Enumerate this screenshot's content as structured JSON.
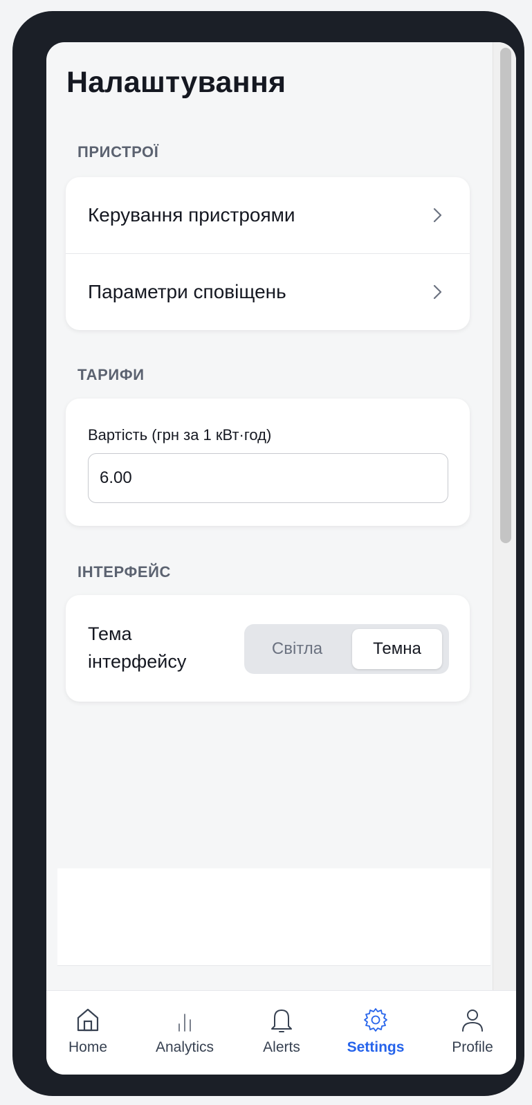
{
  "header": {
    "title": "Налаштування"
  },
  "sections": {
    "devices": {
      "label": "ПРИСТРОЇ",
      "items": [
        {
          "label": "Керування пристроями"
        },
        {
          "label": "Параметри сповіщень"
        }
      ]
    },
    "tariffs": {
      "label": "ТАРИФИ",
      "cost_label": "Вартість (грн за 1 кВт·год)",
      "cost_value": "6.00"
    },
    "interface": {
      "label": "ІНТЕРФЕЙС",
      "theme_label": "Тема інтерфейсу",
      "options": [
        "Світла",
        "Темна"
      ],
      "selected": "Темна"
    }
  },
  "tabbar": {
    "items": [
      {
        "label": "Home",
        "icon": "home-icon"
      },
      {
        "label": "Analytics",
        "icon": "analytics-icon"
      },
      {
        "label": "Alerts",
        "icon": "bell-icon"
      },
      {
        "label": "Settings",
        "icon": "gear-icon"
      },
      {
        "label": "Profile",
        "icon": "user-icon"
      }
    ],
    "active": "Settings"
  },
  "colors": {
    "accent": "#2563eb",
    "frame": "#1b1f27",
    "background": "#f5f6f7",
    "text": "#151821",
    "muted": "#5b6270"
  }
}
